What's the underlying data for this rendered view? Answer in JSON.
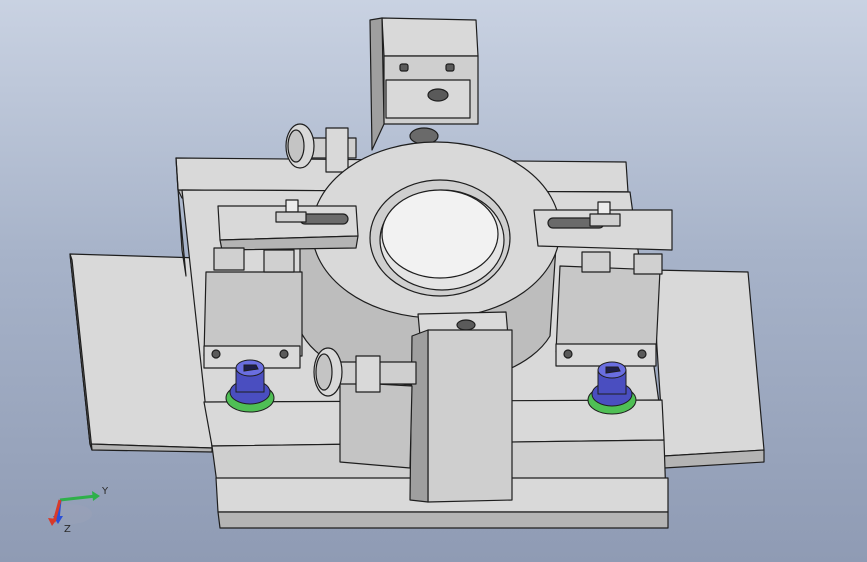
{
  "viewport": {
    "background_top": "#c9d2e2",
    "background_bottom": "#8f9bb4"
  },
  "model": {
    "part_color": "#d9d9d9",
    "part_shade": "#b4b4b4",
    "part_dark": "#8c8c8c",
    "edge_color": "#1e1e1e",
    "screw_color": "#4a4ec0",
    "washer_color": "#4fbf55"
  },
  "triad": {
    "x_color": "#d83a2a",
    "y_color": "#2eb04a",
    "z_color": "#2a4ed8",
    "y_label": "Y",
    "z_label": "Z"
  }
}
